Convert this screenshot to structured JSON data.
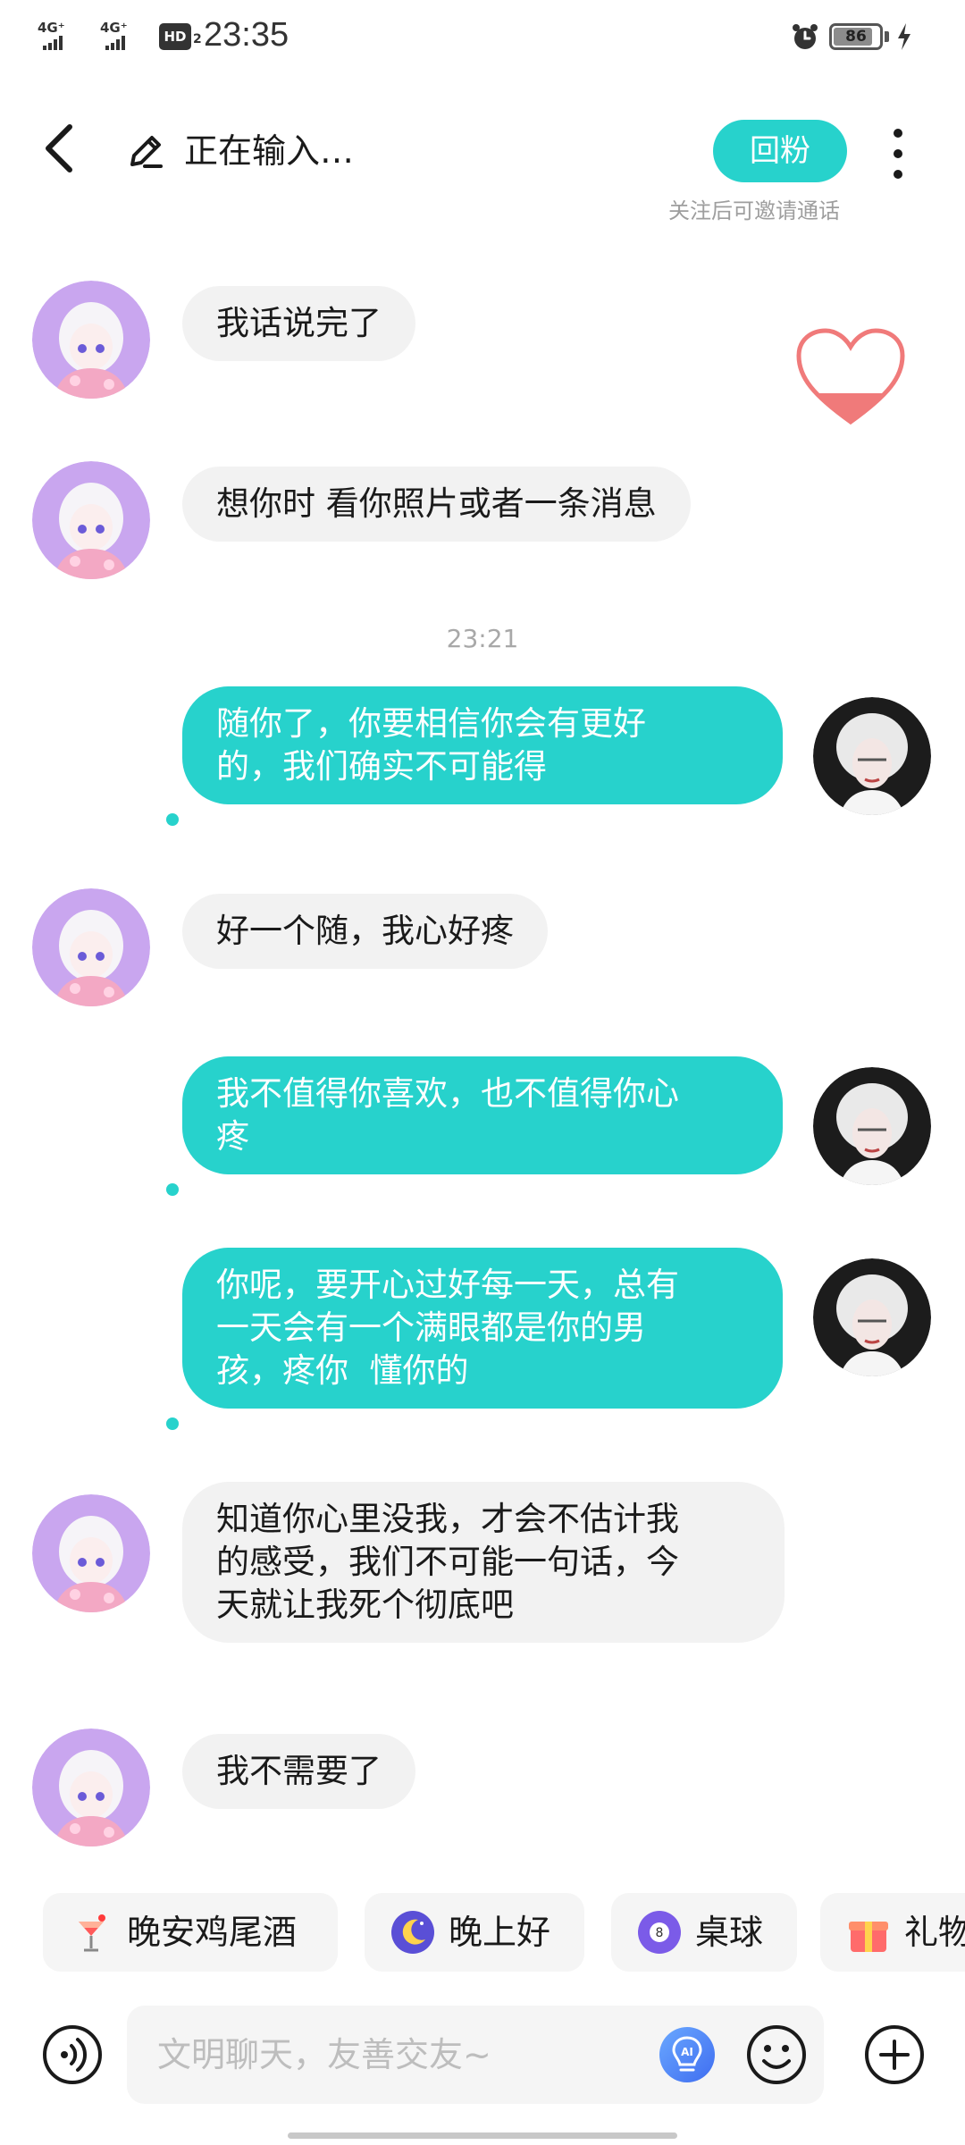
{
  "status_bar": {
    "network_1": "4G⁺",
    "network_2": "4G⁺",
    "hd": "HD",
    "hd_sub": "2",
    "time": "23:35",
    "battery_level": 86,
    "battery_text": "86",
    "icons": [
      "signal-icon",
      "hd-voice-icon",
      "alarm-icon",
      "battery-icon",
      "charging-icon"
    ]
  },
  "header": {
    "title": "正在输入…",
    "follow_button": "回粉",
    "follow_hint": "关注后可邀请通话",
    "icons": [
      "back-arrow-icon",
      "pencil-icon",
      "more-dots-icon"
    ]
  },
  "chat": {
    "timestamp": "23:21",
    "messages": [
      {
        "side": "in",
        "text": "我话说完了"
      },
      {
        "side": "in",
        "text": "想你时 看你照片或者一条消息"
      },
      {
        "side": "out",
        "text": "随你了，你要相信你会有更好\n的，我们确实不可能得"
      },
      {
        "side": "in",
        "text": "好一个随，我心好疼"
      },
      {
        "side": "out",
        "text": "我不值得你喜欢，也不值得你心\n疼"
      },
      {
        "side": "out",
        "text": "你呢，要开心过好每一天，总有\n一天会有一个满眼都是你的男\n孩，疼你  懂你的"
      },
      {
        "side": "in",
        "text": "知道你心里没我，才会不估计我\n的感受，我们不可能一句话，今\n天就让我死个彻底吧"
      },
      {
        "side": "in",
        "text": "我不需要了"
      }
    ]
  },
  "quick_replies": [
    {
      "label": "晚安鸡尾酒",
      "icon": "cocktail-icon"
    },
    {
      "label": "晚上好",
      "icon": "moon-icon"
    },
    {
      "label": "桌球",
      "icon": "billiard-ball-icon"
    },
    {
      "label": "礼物",
      "icon": "gift-icon"
    }
  ],
  "input": {
    "placeholder": "文明聊天，友善交友~",
    "value": ""
  },
  "colors": {
    "accent": "#27d2cc",
    "incoming_bubble": "#f2f2f2",
    "outgoing_text": "#ffffff",
    "heart": "#f07a7a"
  }
}
